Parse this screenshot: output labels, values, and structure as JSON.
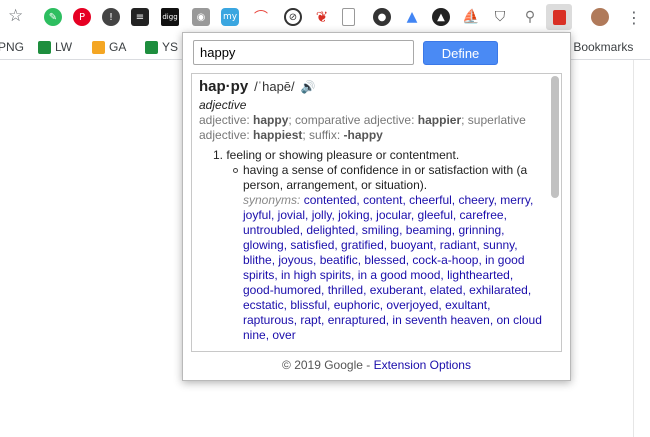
{
  "bookmarks": [
    {
      "label": "PNG",
      "color": "#ffffff"
    },
    {
      "label": "LW",
      "color": "#1e8e3e"
    },
    {
      "label": "GA",
      "color": "#f4a623"
    },
    {
      "label": "YS",
      "color": "#1e8e3e"
    },
    {
      "label": "r Bookmarks",
      "color": "#ffffff"
    }
  ],
  "popup": {
    "search_value": "happy",
    "define_label": "Define",
    "headword": "hap·py",
    "pronunciation": "/ˈhapē/",
    "pos": "adjective",
    "forms": {
      "p1": "adjective: ",
      "b1": "happy",
      "p2": "; comparative adjective: ",
      "b2": "happier",
      "p3": "; superlative adjective: ",
      "b3": "happiest",
      "p4": "; suffix: ",
      "b4": "-happy"
    },
    "sense1": "1. feeling or showing pleasure or contentment.",
    "subsense1": "having a sense of confidence in or satisfaction with (a person, arrangement, or situation).",
    "synonyms_label": "synonyms:",
    "synonyms": "contented, content, cheerful, cheery, merry, joyful, jovial, jolly, joking, jocular, gleeful, carefree, untroubled, delighted, smiling, beaming, grinning, glowing, satisfied, gratified, buoyant, radiant, sunny, blithe, joyous, beatific, blessed, cock-a-hoop, in good spirits, in high spirits, in a good mood, lighthearted, good-humored, thrilled, exuberant, elated, exhilarated, ecstatic, blissful, euphoric, overjoyed, exultant, rapturous, rapt, enraptured, in seventh heaven, on cloud nine, over",
    "footer_copy": "© 2019 Google - ",
    "footer_link": "Extension Options"
  }
}
